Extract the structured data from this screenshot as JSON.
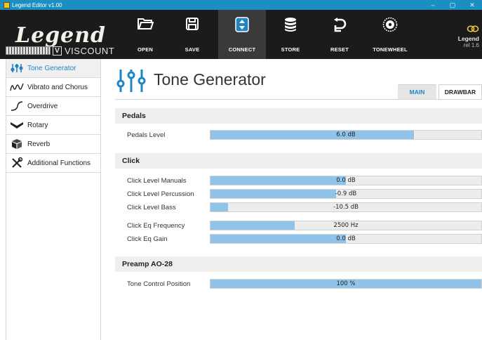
{
  "window": {
    "title": "Legend Editor v1.00",
    "minimize": "–",
    "maximize": "▢",
    "close": "✕"
  },
  "toolbar": {
    "brand_word": "Legend",
    "brand_sub": "VISCOUNT",
    "brand_v": "V",
    "buttons": [
      {
        "label": "OPEN",
        "icon": "folder-icon"
      },
      {
        "label": "SAVE",
        "icon": "floppy-save-icon"
      },
      {
        "label": "CONNECT",
        "icon": "connect-arrows-icon",
        "active": true
      },
      {
        "label": "STORE",
        "icon": "database-store-icon"
      },
      {
        "label": "RESET",
        "icon": "undo-reset-icon"
      },
      {
        "label": "TONEWHEEL",
        "icon": "tonewheel-icon"
      }
    ],
    "device_name": "Legend",
    "device_version": "rel 1.6"
  },
  "sidebar": {
    "items": [
      {
        "label": "Tone Generator",
        "icon": "sliders-icon",
        "active": true
      },
      {
        "label": "Vibrato and Chorus",
        "icon": "vibrato-wave-icon"
      },
      {
        "label": "Overdrive",
        "icon": "overdrive-curve-icon"
      },
      {
        "label": "Rotary",
        "icon": "rotary-speaker-icon"
      },
      {
        "label": "Reverb",
        "icon": "reverb-cube-icon"
      },
      {
        "label": "Additional Functions",
        "icon": "tools-icon"
      }
    ]
  },
  "main": {
    "title": "Tone Generator",
    "tabs": [
      {
        "label": "MAIN",
        "active": true
      },
      {
        "label": "DRAWBAR",
        "active": false
      }
    ],
    "sections": [
      {
        "title": "Pedals",
        "rows": [
          {
            "label": "Pedals Level",
            "value": "6.0 dB",
            "fill": 0.75
          }
        ]
      },
      {
        "title": "Click",
        "rows": [
          {
            "label": "Click Level Manuals",
            "value": "0.0 dB",
            "fill": 0.5
          },
          {
            "label": "Click Level Percussion",
            "value": "-0.9 dB",
            "fill": 0.465
          },
          {
            "label": "Click Level Bass",
            "value": "-10.5 dB",
            "fill": 0.065
          },
          {
            "label": "Click Eq Frequency",
            "value": "2500 Hz",
            "fill": 0.31
          },
          {
            "label": "Click Eq Gain",
            "value": "0.0 dB",
            "fill": 0.5
          }
        ]
      },
      {
        "title": "Preamp AO-28",
        "rows": [
          {
            "label": "Tone Control Position",
            "value": "100 %",
            "fill": 1.0
          }
        ]
      }
    ]
  },
  "colors": {
    "titlebar": "#1c8fc2",
    "toolbar": "#1b1b1b",
    "accent": "#1f86c2",
    "slider_fill": "#8fc3e9",
    "section_bg": "#eeeeee"
  }
}
